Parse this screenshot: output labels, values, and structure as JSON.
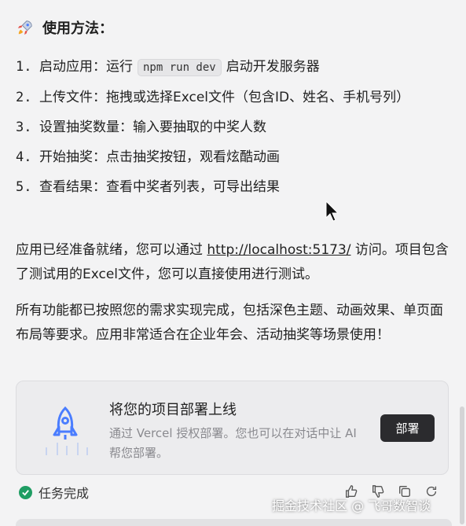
{
  "heading": {
    "icon": "rocket-icon",
    "text": "使用方法："
  },
  "steps": [
    {
      "num": "1.",
      "label": "启动应用：运行",
      "code": "npm run dev",
      "after": "启动开发服务器"
    },
    {
      "num": "2.",
      "label": "上传文件：拖拽或选择Excel文件（包含ID、姓名、手机号列）"
    },
    {
      "num": "3.",
      "label": "设置抽奖数量：输入要抽取的中奖人数"
    },
    {
      "num": "4.",
      "label": "开始抽奖：点击抽奖按钮，观看炫酷动画"
    },
    {
      "num": "5.",
      "label": "查看结果：查看中奖者列表，可导出结果"
    }
  ],
  "para1": {
    "before": "应用已经准备就绪，您可以通过 ",
    "link": "http://localhost:5173/",
    "after": " 访问。项目包含了测试用的Excel文件，您可以直接使用进行测试。"
  },
  "para2": "所有功能都已按照您的需求实现完成，包括深色主题、动画效果、单页面布局等要求。应用非常适合在企业年会、活动抽奖等场景使用！",
  "deploy": {
    "title": "将您的项目部署上线",
    "desc": "通过 Vercel 授权部署。您也可以在对话中让 AI 帮您部署。",
    "button": "部署"
  },
  "status": {
    "text": "任务完成"
  },
  "watermark": "掘金技术社区 @ 飞哥数智谈",
  "colors": {
    "accent": "#4a7dff",
    "success": "#1f9d63",
    "button_bg": "#2b2b2e"
  }
}
